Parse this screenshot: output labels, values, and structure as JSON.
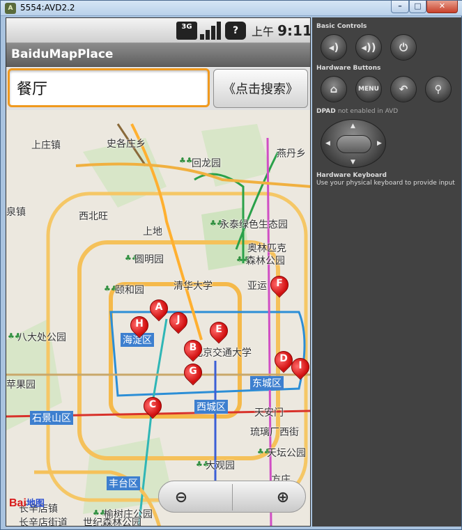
{
  "window": {
    "title": "5554:AVD2.2",
    "app_icon": "android-app-icon",
    "minimize_glyph": "–",
    "maximize_glyph": "□",
    "close_glyph": "✕"
  },
  "status_bar": {
    "network": "3G",
    "alert_glyph": "?",
    "ampm": "上午",
    "time": "9:11"
  },
  "app": {
    "title": "BaiduMapPlace"
  },
  "search": {
    "value": "餐厅",
    "button_label": "《点击搜索》"
  },
  "map": {
    "places": [
      "上庄镇",
      "史各庄乡",
      "燕丹乡",
      "回龙园",
      "泉镇",
      "西北旺",
      "上地",
      "永泰绿色生态园",
      "奥林匹克",
      "森林公园",
      "圆明园",
      "颐和园",
      "清华大学",
      "亚运",
      "八大处公园",
      "北京交通大学",
      "苹果园",
      "天安门",
      "琉璃厂",
      "西街",
      "天坛公园",
      "大观园",
      "方庄",
      "长辛店镇",
      "榆树庄公园",
      "长辛店街道",
      "世纪森林公园"
    ],
    "districts": [
      "海淀区",
      "东城区",
      "石景山区",
      "西城区",
      "丰台区"
    ],
    "markers": [
      "A",
      "B",
      "C",
      "D",
      "E",
      "F",
      "G",
      "H",
      "I",
      "J"
    ],
    "logo_text": "Bai",
    "logo_sub": "地图"
  },
  "panel": {
    "basic_controls": "Basic Controls",
    "hardware_buttons": "Hardware Buttons",
    "dpad": "DPAD",
    "dpad_note": "not enabled in AVD",
    "keyboard": "Hardware Keyboard",
    "keyboard_note": "Use your physical keyboard to provide input",
    "menu_label": "MENU"
  },
  "colors": {
    "search_focus": "#f0991e",
    "marker_red": "#d10f0f",
    "district_blue": "#3d7fcf",
    "panel_bg": "#424242"
  }
}
